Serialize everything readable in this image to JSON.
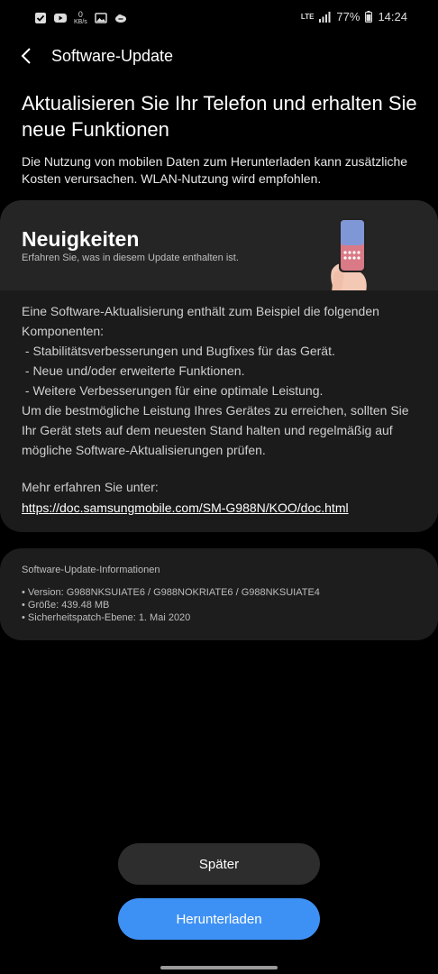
{
  "status_bar": {
    "net_speed_value": "0",
    "net_speed_unit": "KB/s",
    "network": "LTE",
    "battery": "77%",
    "time": "14:24"
  },
  "header": {
    "title": "Software-Update"
  },
  "headline": "Aktualisieren Sie Ihr Telefon und erhalten Sie neue Funktionen",
  "subtext": "Die Nutzung von mobilen Daten zum Herunterladen kann zusätzliche Kosten verursachen. WLAN-Nutzung wird empfohlen.",
  "news": {
    "title": "Neuigkeiten",
    "subtitle": "Erfahren Sie, was in diesem Update enthalten ist.",
    "body": [
      "Eine Software-Aktualisierung enthält zum Beispiel die folgenden Komponenten:",
      " - Stabilitätsverbesserungen und Bugfixes für das Gerät.",
      " - Neue und/oder erweiterte Funktionen.",
      " - Weitere Verbesserungen für eine optimale Leistung.",
      "Um die bestmögliche Leistung Ihres Gerätes zu erreichen, sollten Sie Ihr Gerät stets auf dem neuesten Stand halten und regelmäßig auf mögliche Software-Aktualisierungen prüfen."
    ],
    "more_label": "Mehr erfahren Sie unter:",
    "link": "https://doc.samsungmobile.com/SM-G988N/KOO/doc.html"
  },
  "info": {
    "title": "Software-Update-Informationen",
    "items": [
      "• Version: G988NKSUIATE6 / G988NOKRIATE6 / G988NKSUIATE4",
      "• Größe: 439.48 MB",
      "• Sicherheitspatch-Ebene: 1. Mai 2020"
    ]
  },
  "buttons": {
    "later": "Später",
    "download": "Herunterladen"
  },
  "colors": {
    "accent": "#3e91f4",
    "background": "#000000",
    "card": "#252525"
  }
}
